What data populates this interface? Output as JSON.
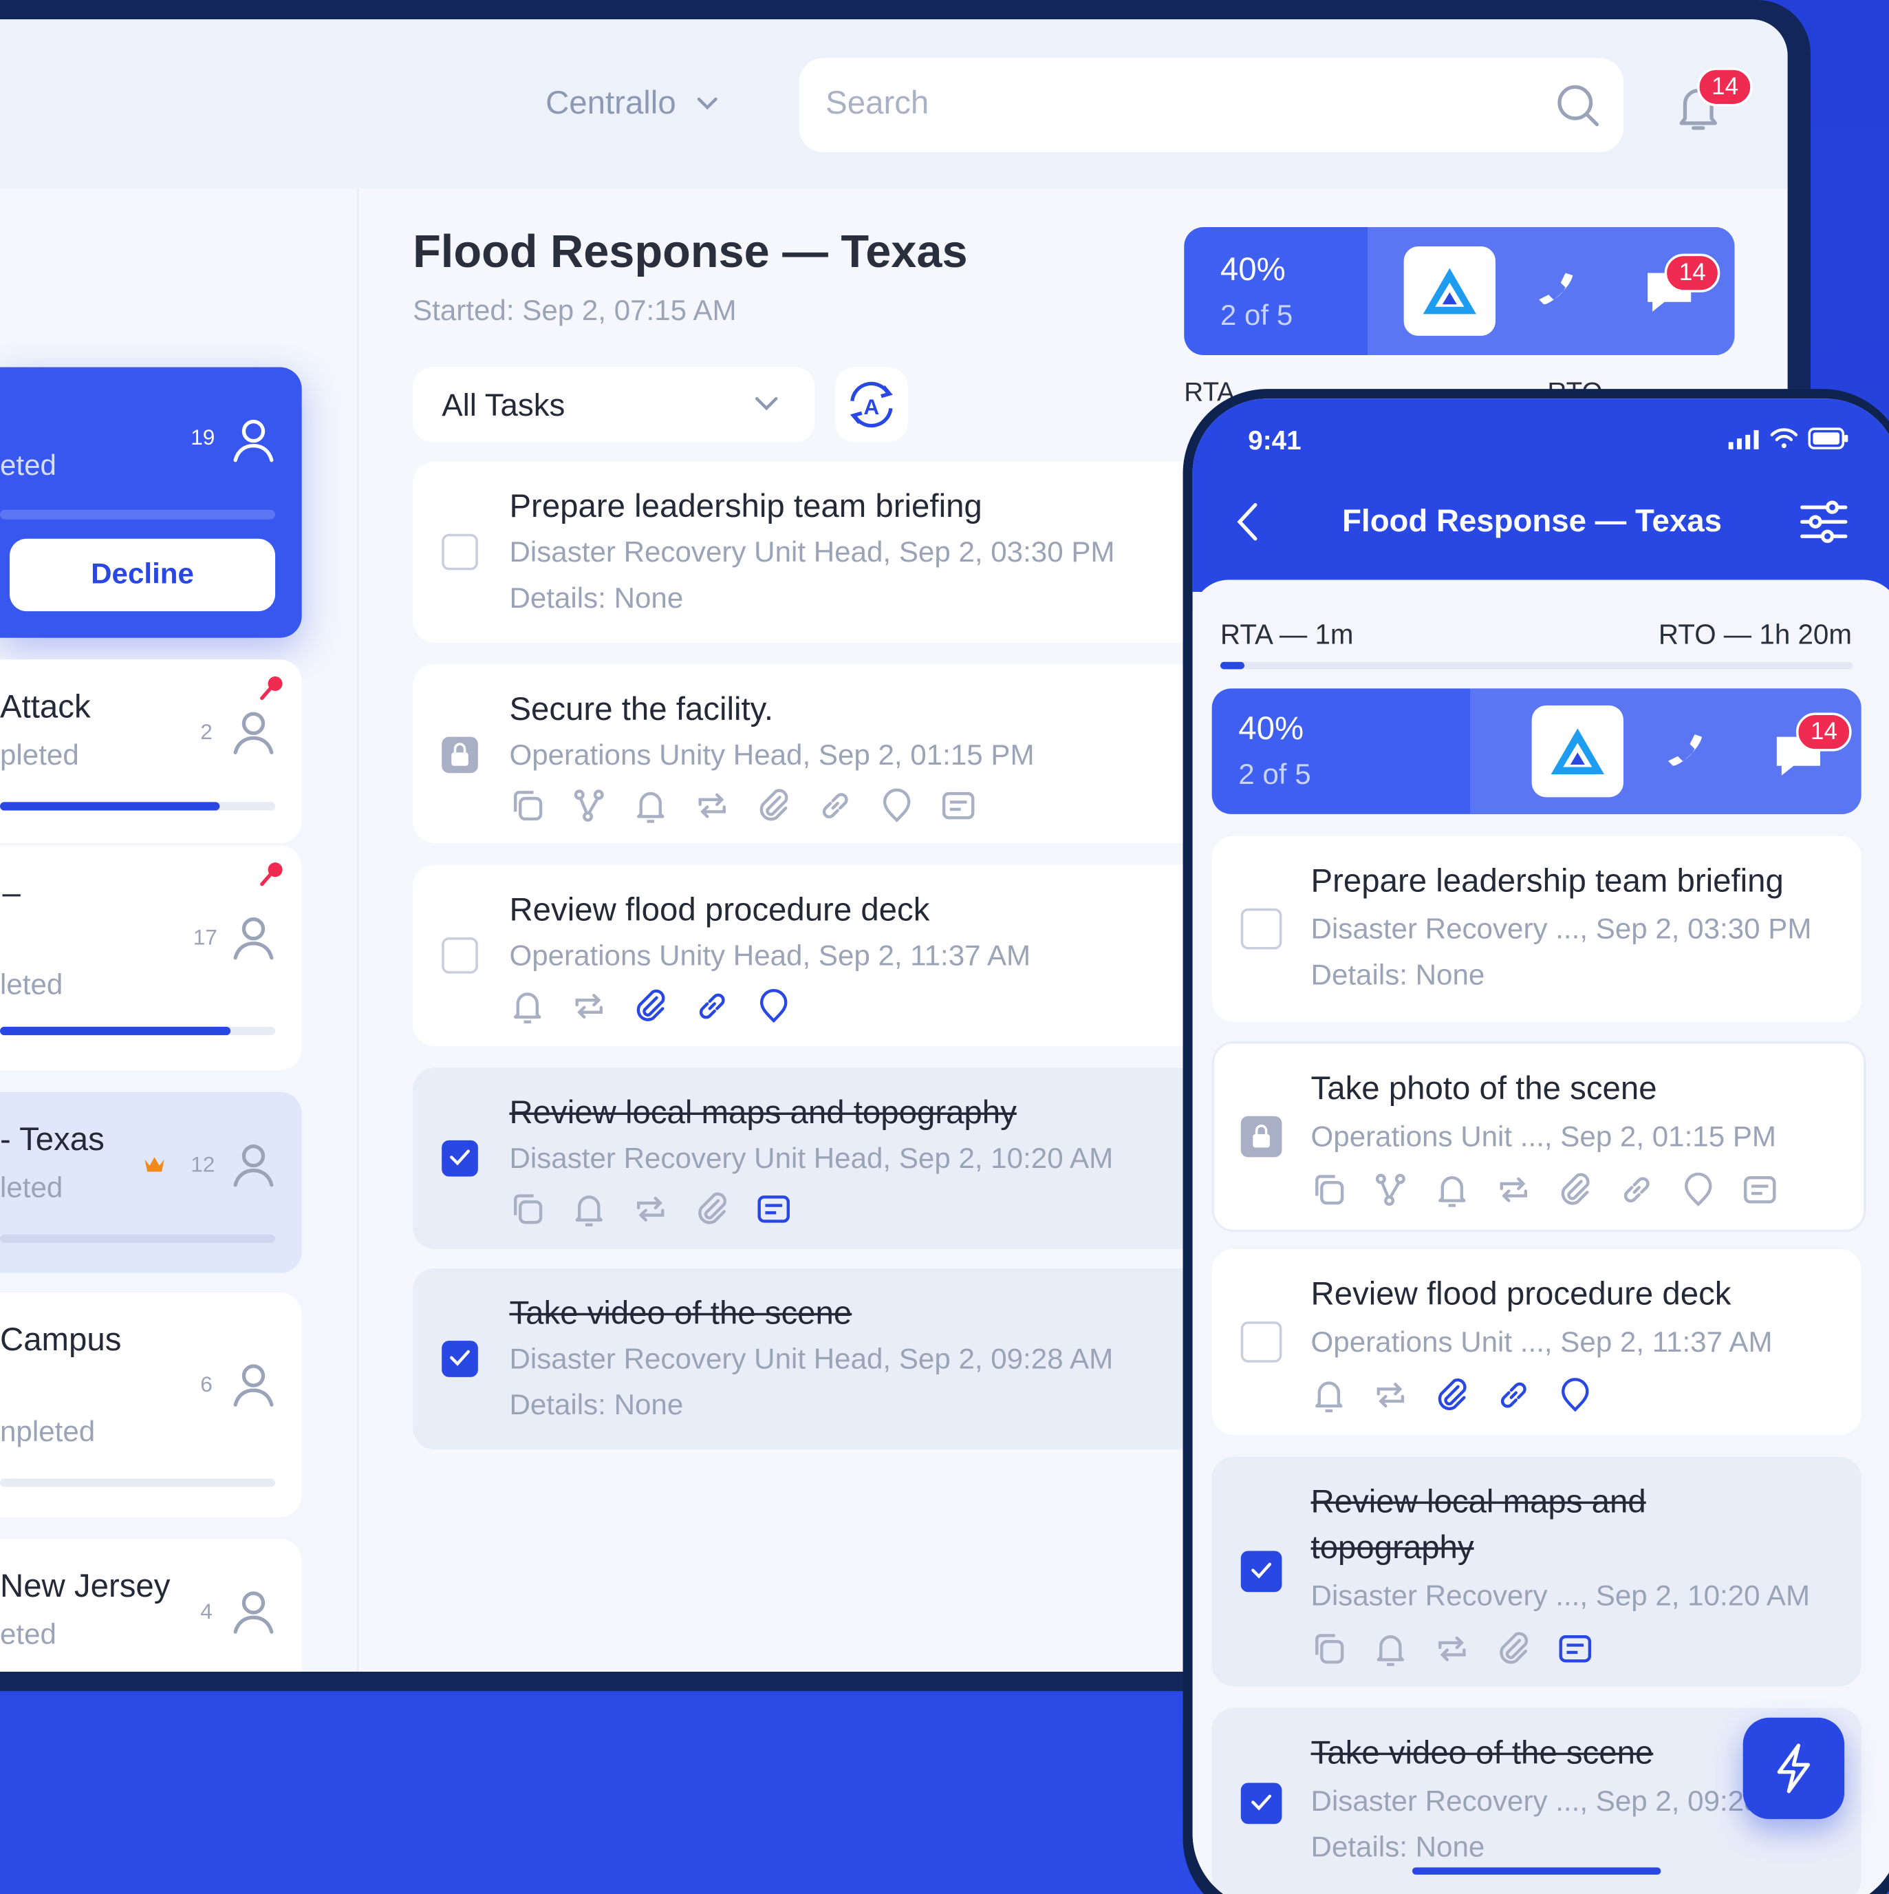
{
  "header": {
    "workspace": "Centrallo",
    "search_placeholder": "Search",
    "notification_count": "14"
  },
  "sidebar": {
    "cards": [
      {
        "title": "",
        "status": "eted",
        "count": "19",
        "action": "Decline"
      },
      {
        "title": "Attack",
        "status": "pleted",
        "count": "2"
      },
      {
        "title": "–",
        "status": "leted",
        "count": "17"
      },
      {
        "title": "- Texas",
        "status": "leted",
        "count": "12"
      },
      {
        "title": "Campus",
        "status": "npleted",
        "count": "6"
      },
      {
        "title": "New Jersey",
        "status": "eted",
        "count": "4"
      }
    ]
  },
  "incident": {
    "title": "Flood Response — Texas",
    "started": "Started: Sep 2, 07:15 AM"
  },
  "progress": {
    "percent_label": "40%",
    "count_label": "2 of 5",
    "chat_count": "14",
    "value": 0.4
  },
  "timer": {
    "rta": "RTA — 1m",
    "rto": "RTO — 1h 20m",
    "rta_short": "RTA",
    "rto_short": "RTO"
  },
  "filter": {
    "selected": "All Tasks"
  },
  "tasks": [
    {
      "title": "Prepare leadership team briefing",
      "meta": "Disaster Recovery Unit Head, Sep 2, 03:30 PM",
      "details": "Details: None"
    },
    {
      "title": "Secure the facility.",
      "meta": "Operations Unity Head, Sep 2, 01:15 PM"
    },
    {
      "title": "Review flood procedure deck",
      "meta": "Operations Unity Head, Sep 2, 11:37 AM"
    },
    {
      "title": "Review local maps and topography",
      "meta": "Disaster Recovery Unit Head, Sep 2, 10:20 AM"
    },
    {
      "title": "Take video of the scene",
      "meta": "Disaster Recovery Unit Head, Sep 2, 09:28 AM",
      "details": "Details: None"
    }
  ],
  "phone": {
    "time": "9:41",
    "title": "Flood Response — Texas",
    "tasks": [
      {
        "title": "Prepare leadership team briefing",
        "meta": "Disaster Recovery ..., Sep 2, 03:30 PM",
        "details": "Details: None"
      },
      {
        "title": "Take photo of the scene",
        "meta": "Operations Unit ..., Sep 2, 01:15 PM"
      },
      {
        "title": "Review flood procedure deck",
        "meta": "Operations Unit ..., Sep 2, 11:37 AM"
      },
      {
        "title_line1": "Review local maps and",
        "title_line2": "topography",
        "meta": "Disaster Recovery ..., Sep 2, 10:20 AM"
      },
      {
        "title": "Take video of the scene",
        "meta": "Disaster Recovery ..., Sep 2, 09:28 AM",
        "details": "Details: None"
      }
    ]
  },
  "colors": {
    "accent": "#2847e3",
    "badge": "#ef2b51",
    "pin": "#ef2b51",
    "crown": "#f08a1a"
  }
}
